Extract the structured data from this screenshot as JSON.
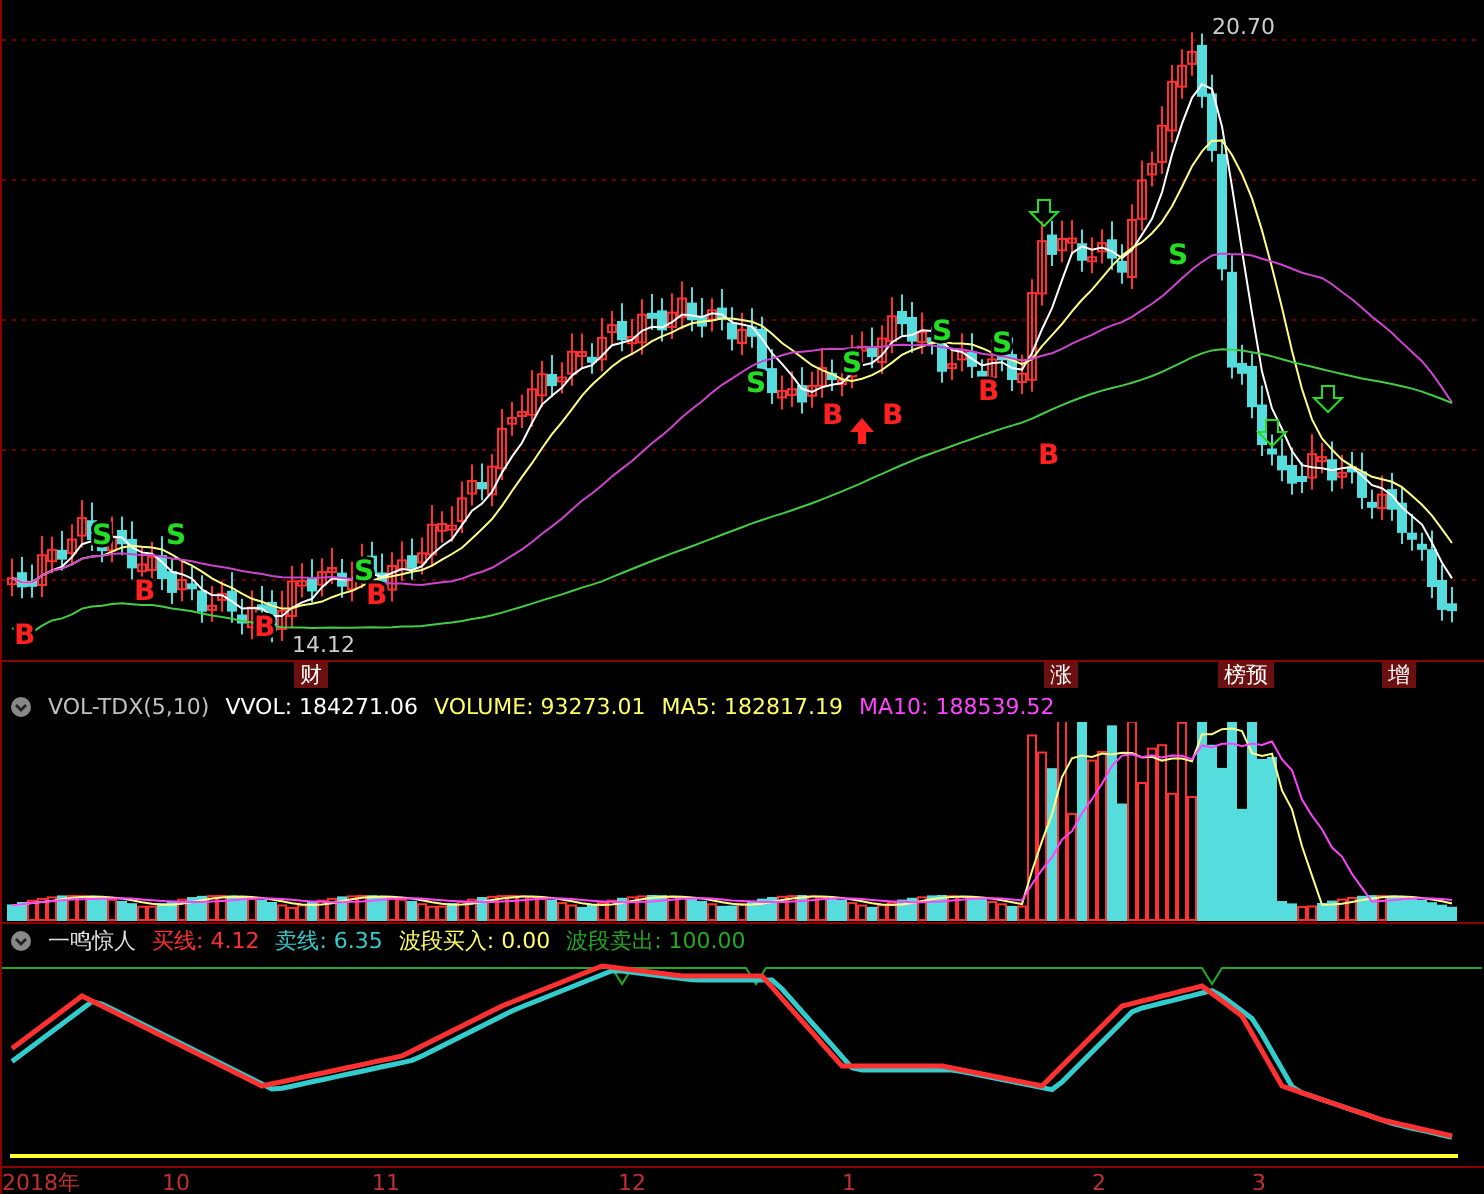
{
  "price_panel": {
    "high_label": "20.70",
    "low_label": "14.12",
    "signals": [
      {
        "text": "B",
        "kind": "buy"
      },
      {
        "text": "B",
        "kind": "buy"
      },
      {
        "text": "B",
        "kind": "buy"
      },
      {
        "text": "B",
        "kind": "buy"
      },
      {
        "text": "B",
        "kind": "buy"
      },
      {
        "text": "B",
        "kind": "buy"
      },
      {
        "text": "B",
        "kind": "buy"
      },
      {
        "text": "B",
        "kind": "buy"
      },
      {
        "text": "S",
        "kind": "sell"
      },
      {
        "text": "S",
        "kind": "sell"
      },
      {
        "text": "S",
        "kind": "sell"
      },
      {
        "text": "S",
        "kind": "sell"
      },
      {
        "text": "S",
        "kind": "sell"
      },
      {
        "text": "S",
        "kind": "sell"
      },
      {
        "text": "S",
        "kind": "sell"
      },
      {
        "text": "S",
        "kind": "sell"
      }
    ],
    "events": [
      {
        "text": "财"
      },
      {
        "text": "涨"
      },
      {
        "text": "榜预"
      },
      {
        "text": "增"
      }
    ]
  },
  "volume_panel": {
    "items": [
      {
        "text": "VOL-TDX(5,10)",
        "color": "#c0c0c0"
      },
      {
        "text": "VVOL: 184271.06",
        "color": "#ffffff"
      },
      {
        "text": "VOLUME: 93273.01",
        "color": "#ffff66"
      },
      {
        "text": "MA5: 182817.19",
        "color": "#ffff66"
      },
      {
        "text": "MA10: 188539.52",
        "color": "#ff44ff"
      }
    ]
  },
  "indicator_panel": {
    "title": "一鸣惊人",
    "items": [
      {
        "text": "买线: 4.12",
        "color": "#ff3030"
      },
      {
        "text": "卖线: 6.35",
        "color": "#33cccc"
      },
      {
        "text": "波段买入: 0.00",
        "color": "#ffff66"
      },
      {
        "text": "波段卖出: 100.00",
        "color": "#22aa22"
      }
    ]
  },
  "time_axis": [
    "2018年",
    "10",
    "11",
    "12",
    "1",
    "2",
    "3"
  ]
}
